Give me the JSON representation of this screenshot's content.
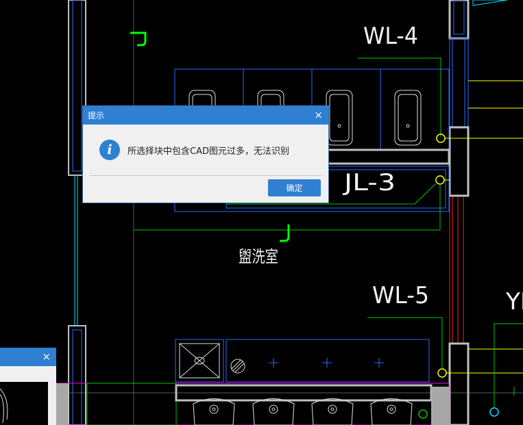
{
  "drawing": {
    "labels": {
      "wl4": "WL-4",
      "jl3": "JL-3",
      "wl5": "WL-5",
      "yl_partial": "YL",
      "room": "盥洗室"
    },
    "colors": {
      "background": "#000000",
      "wall": "#c0c0c0",
      "fixture": "#2a6cff",
      "pipe": "#00c800",
      "yellow": "#ffff00",
      "red": "#ff2020",
      "cyan": "#00e5ff",
      "magenta": "#ff00ff"
    }
  },
  "dialog": {
    "title": "提示",
    "close_glyph": "×",
    "icon": "info-icon",
    "icon_glyph": "i",
    "message": "所选择块中包含CAD图元过多，无法识别",
    "ok_label": "确定"
  },
  "background_dialog": {
    "close_glyph": "×"
  }
}
